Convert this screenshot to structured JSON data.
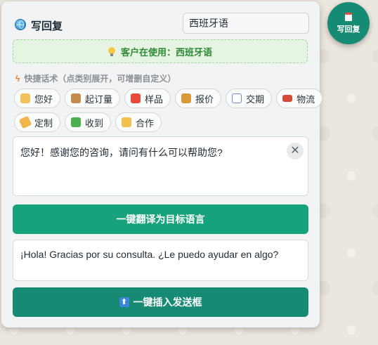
{
  "panel": {
    "title": "写回复",
    "target_language_value": "西班牙语",
    "status": "客户在使用：西班牙语",
    "quick_replies_label": "快捷话术（点类别展开，可增删自定义）",
    "quick_replies": [
      {
        "label": "您好",
        "icon": "waving-hand-icon"
      },
      {
        "label": "起订量",
        "icon": "package-icon"
      },
      {
        "label": "样品",
        "icon": "gift-icon"
      },
      {
        "label": "报价",
        "icon": "money-bag-icon"
      },
      {
        "label": "交期",
        "icon": "calendar-icon"
      },
      {
        "label": "物流",
        "icon": "truck-icon"
      },
      {
        "label": "定制",
        "icon": "tag-icon"
      },
      {
        "label": "收到",
        "icon": "check-icon"
      },
      {
        "label": "合作",
        "icon": "handshake-icon"
      }
    ],
    "input_text": "您好！感谢您的咨询，请问有什么可以帮助您?",
    "clear_symbol": "✕",
    "translate_button": "一键翻译为目标语言",
    "translated_text": "¡Hola! Gracias por su consulta. ¿Le puedo ayudar en algo?",
    "insert_button": "一键插入发送框"
  },
  "fab": {
    "label": "写回复"
  },
  "colors": {
    "primary": "#16a27a",
    "insert": "#168a73",
    "status_bg": "#e6f4e3",
    "status_text": "#2e8a35"
  }
}
